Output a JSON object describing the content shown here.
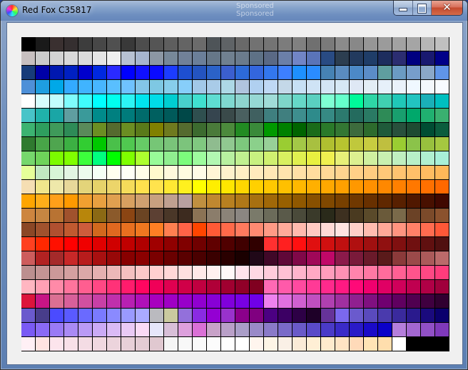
{
  "window": {
    "title": "Red Fox C35817",
    "background_ghost_text": "Sponsored\nSponsored",
    "close_symbol": "✕"
  },
  "palette": {
    "columns": 30,
    "rows": 22,
    "colors": [
      "#000000",
      "#1a1a1a",
      "#3a3030",
      "#352f30",
      "#3d3d3d",
      "#474747",
      "#505050",
      "#393939",
      "#4d4d4d",
      "#555555",
      "#5e5e5e",
      "#646464",
      "#6b6b6b",
      "#4e5458",
      "#5f6366",
      "#696969",
      "#727272",
      "#747474",
      "#7c7c7c",
      "#808080",
      "#707070",
      "#7a7a7a",
      "#8b8b8b",
      "#888888",
      "#969696",
      "#9b9b9b",
      "#a2a2a2",
      "#a5a5a5",
      "#b6b6b6",
      "#c0c0c0",
      "#c8c0c0",
      "#cbcbcb",
      "#d3d3d3",
      "#d9d9d9",
      "#dcdcdc",
      "#e5e5e5",
      "#efefef",
      "#b7c1d2",
      "#a6b5ce",
      "#8c97a4",
      "#778899",
      "#718198",
      "#6b7f99",
      "#667788",
      "#708090",
      "#6b7b8c",
      "#5e7186",
      "#5a6985",
      "#6b7fa8",
      "#7185c6",
      "#5a74b8",
      "#294b83",
      "#2c3e50",
      "#223a5e",
      "#1f3d68",
      "#1d2d5e",
      "#2b2d71",
      "#000080",
      "#191970",
      "#000088",
      "#183c7a",
      "#0000a8",
      "#0018b0",
      "#0020c2",
      "#0000cd",
      "#0028e0",
      "#2a2aff",
      "#0000ff",
      "#1010ff",
      "#0a0aff",
      "#1c3cff",
      "#1e4fd0",
      "#2454c0",
      "#2b62c8",
      "#3b5fcf",
      "#2d6ad8",
      "#3366dd",
      "#3377ee",
      "#3d7fff",
      "#1e90ff",
      "#2a8cff",
      "#4682b4",
      "#5a8cc0",
      "#4c89c7",
      "#5b8dc8",
      "#5f9ea0",
      "#6b9bc3",
      "#779ecb",
      "#8ba8c8",
      "#6095e8",
      "#4e90d8",
      "#1e9ee0",
      "#00a8e8",
      "#33aaff",
      "#40b4ff",
      "#47b6ff",
      "#59bfff",
      "#6fc2ff",
      "#83c5e8",
      "#7ec8e3",
      "#87ceeb",
      "#87cefa",
      "#a2c8e8",
      "#a9cbe8",
      "#add8e6",
      "#b0c4de",
      "#b0d0f0",
      "#bfd8f5",
      "#c4d8e8",
      "#c7e0f5",
      "#cfe3f5",
      "#d3e5f5",
      "#d6e8f5",
      "#dfe8f5",
      "#e3edf5",
      "#e6f0fa",
      "#eaf2fa",
      "#f0f8ff",
      "#f4f8fc",
      "#f8fbff",
      "#ffffff",
      "#d7fdfd",
      "#c1fdfd",
      "#7ffcfc",
      "#40fcfc",
      "#00ffff",
      "#00ffee",
      "#2cf4f4",
      "#00e5ee",
      "#00dce8",
      "#00ced1",
      "#48d1cc",
      "#40e0d0",
      "#5fdcd2",
      "#7fd8d0",
      "#8ed4ce",
      "#96d8d4",
      "#a0dcd8",
      "#7ed6c9",
      "#66d8c8",
      "#5ad0c0",
      "#7fffd4",
      "#66ffcc",
      "#00fa9a",
      "#2ed6a6",
      "#40d0b0",
      "#20c8b8",
      "#22c4c0",
      "#1ab0b8",
      "#00bfbf",
      "#48c4c8",
      "#20b2aa",
      "#1aa6a6",
      "#5f9ea0",
      "#3a9a9a",
      "#008b8b",
      "#008080",
      "#007b7b",
      "#006b6b",
      "#006060",
      "#005a5a",
      "#004848",
      "#2f4f4f",
      "#36454f",
      "#3a4a4a",
      "#4a6060",
      "#406060",
      "#3f7f7f",
      "#407f7f",
      "#3e8e8e",
      "#2e8b8b",
      "#368a84",
      "#2c7a6e",
      "#246b5e",
      "#2a7a64",
      "#2e8b57",
      "#199f6e",
      "#00a86b",
      "#20b070",
      "#3ab070",
      "#3cb371",
      "#2e9e5e",
      "#3f9a5a",
      "#2e8b57",
      "#5a8a5a",
      "#6b8e23",
      "#556b2f",
      "#6b8e23",
      "#5a7a1a",
      "#808000",
      "#6f7a1f",
      "#556b2f",
      "#3c6b2f",
      "#4a7a3a",
      "#4c8a3c",
      "#228b22",
      "#3a8a3a",
      "#009900",
      "#008000",
      "#006400",
      "#1a6b1a",
      "#2a7a2a",
      "#337733",
      "#3d6b3d",
      "#2d6b2d",
      "#1f5a3a",
      "#28503c",
      "#1e4b32",
      "#004d33",
      "#0b5d3d",
      "#2f7a2f",
      "#48a548",
      "#4fa54f",
      "#3cb043",
      "#32cd32",
      "#00c800",
      "#4ac04a",
      "#50c850",
      "#66cc66",
      "#76c676",
      "#7ac47a",
      "#7cc47c",
      "#80c880",
      "#8fbc8f",
      "#90c890",
      "#7dc87d",
      "#8bd08b",
      "#98d098",
      "#9acd32",
      "#a3c847",
      "#a8c040",
      "#b0c030",
      "#b8c430",
      "#c0c83c",
      "#c8cc40",
      "#bfbf3f",
      "#9acd32",
      "#8bc34a",
      "#98c03e",
      "#a5c840",
      "#76d76c",
      "#6ed35a",
      "#7cfc00",
      "#80ff00",
      "#3cff3c",
      "#00ff7f",
      "#00ff00",
      "#7fff00",
      "#adff2f",
      "#98fb98",
      "#90ee90",
      "#7cfc7c",
      "#9efc9e",
      "#b2f7b2",
      "#b8f0a0",
      "#c0f090",
      "#c8f080",
      "#d0f070",
      "#d8f060",
      "#e0f050",
      "#e8f040",
      "#f0f050",
      "#e8f078",
      "#dcf090",
      "#d0f0a0",
      "#c8f0b0",
      "#c0f0c0",
      "#b8f0c8",
      "#b0f0d0",
      "#a8f0d8",
      "#e6ff99",
      "#c1e8c1",
      "#d7f5d7",
      "#e3f5e3",
      "#edfced",
      "#f5fff5",
      "#fffff0",
      "#fffff5",
      "#fffde7",
      "#fffacd",
      "#fff8dc",
      "#fffce0",
      "#fffbe6",
      "#fff5d6",
      "#fff2cc",
      "#ffefc4",
      "#ffebbd",
      "#ffe8b5",
      "#ffe4ad",
      "#ffe0a6",
      "#ffdc9e",
      "#ffd896",
      "#ffd48f",
      "#ffd087",
      "#ffcc80",
      "#ffc878",
      "#ffc470",
      "#ffc069",
      "#ffbc61",
      "#ffb859",
      "#f5deb3",
      "#f0e68c",
      "#eee8aa",
      "#e8d89a",
      "#e3d47a",
      "#e6d36a",
      "#ecd56a",
      "#f5dc5a",
      "#ffe14d",
      "#ffe34d",
      "#ffe833",
      "#fff01f",
      "#ffff00",
      "#ffee00",
      "#ffe600",
      "#ffd700",
      "#ffd000",
      "#ffc800",
      "#ffc000",
      "#ffb800",
      "#ffb000",
      "#ffa800",
      "#ffa000",
      "#ff9800",
      "#ff9000",
      "#ff8800",
      "#ff8000",
      "#ff7800",
      "#ff7000",
      "#ff6800",
      "#ffa500",
      "#ffae1a",
      "#ff9f1a",
      "#ff9900",
      "#f0a030",
      "#e8a040",
      "#e0a050",
      "#d8a060",
      "#d0a070",
      "#c8a080",
      "#c0a090",
      "#b8a0a0",
      "#c09040",
      "#c08830",
      "#b88020",
      "#b07818",
      "#a87010",
      "#a06808",
      "#986000",
      "#905800",
      "#885000",
      "#804800",
      "#784000",
      "#703800",
      "#683000",
      "#602800",
      "#582000",
      "#501800",
      "#481000",
      "#400800",
      "#cd853f",
      "#c68642",
      "#b87333",
      "#a0522d",
      "#b8860b",
      "#8b6914",
      "#8b5a2b",
      "#8b4513",
      "#6b4423",
      "#5c4033",
      "#4a3728",
      "#3d2b1f",
      "#8b7355",
      "#8b7d6b",
      "#8b8378",
      "#8b8682",
      "#7a7a6a",
      "#6b6b5a",
      "#5a5a4a",
      "#4a4a3a",
      "#3a3a2a",
      "#2a2a1a",
      "#3d3020",
      "#4a3a20",
      "#5a4a2a",
      "#6a5a3a",
      "#7a6a4a",
      "#6b4226",
      "#7b4a2a",
      "#8b522e",
      "#8b4726",
      "#a0522d",
      "#b05030",
      "#c05a30",
      "#cd5c3c",
      "#d2691e",
      "#e06820",
      "#e87020",
      "#f07820",
      "#ff7f24",
      "#ff7f50",
      "#ff6347",
      "#ff4500",
      "#ff5a36",
      "#ff6a4a",
      "#ff7a5e",
      "#ff8a72",
      "#ff9a86",
      "#ffaa9a",
      "#ffbaae",
      "#ffcac2",
      "#ffdad6",
      "#ffe4e1",
      "#ffd0c8",
      "#ffbcb0",
      "#ffa898",
      "#ff9480",
      "#ff8068",
      "#ff6c50",
      "#ff5838",
      "#ff4020",
      "#ff2800",
      "#ff1000",
      "#ff0000",
      "#f00000",
      "#e00000",
      "#d00000",
      "#c00000",
      "#b00000",
      "#a00000",
      "#900000",
      "#800000",
      "#700000",
      "#600000",
      "#500000",
      "#400000",
      "#300000",
      "#ff3030",
      "#ff2020",
      "#ff1010",
      "#e01010",
      "#d01010",
      "#c01010",
      "#b01010",
      "#a01010",
      "#901010",
      "#801010",
      "#701010",
      "#601010",
      "#501010",
      "#cd5c5c",
      "#b22222",
      "#a52a2a",
      "#c82828",
      "#b81c1c",
      "#a81010",
      "#980808",
      "#880000",
      "#8b0000",
      "#7a0000",
      "#6a0000",
      "#5a0000",
      "#4a0000",
      "#3a0000",
      "#2a0000",
      "#1a0000",
      "#200818",
      "#400828",
      "#600838",
      "#800848",
      "#a00858",
      "#c00868",
      "#8b1a4a",
      "#7a1a3a",
      "#6a1a2a",
      "#5a1a1a",
      "#8b3a3a",
      "#9b4a4a",
      "#ab5a5a",
      "#bb6a6a",
      "#bc8f8f",
      "#c49494",
      "#cc9999",
      "#d4a0a0",
      "#dca8a8",
      "#e4b0b0",
      "#ecb8b8",
      "#f4c0c0",
      "#fcc8c8",
      "#ffd0d0",
      "#ffd8d8",
      "#ffe0e0",
      "#ffe8e8",
      "#fff0f0",
      "#fff8f8",
      "#ffe4ec",
      "#ffd8e4",
      "#ffccdc",
      "#ffc0d4",
      "#ffb4cc",
      "#ffa8c4",
      "#ff9cbc",
      "#ff90b4",
      "#ff84ac",
      "#ff78a4",
      "#ff6c9c",
      "#ff6094",
      "#ff548c",
      "#ff4884",
      "#ff3c7c",
      "#ffb6c1",
      "#ffa0b4",
      "#ff8aa8",
      "#ff749c",
      "#ff5e90",
      "#ff4884",
      "#ff3278",
      "#ff1c6c",
      "#ff0660",
      "#f00058",
      "#e00050",
      "#d00048",
      "#c00040",
      "#b00038",
      "#a00030",
      "#900028",
      "#800020",
      "#ff69b4",
      "#ff5aaa",
      "#ff4aa0",
      "#ff3a96",
      "#ff2a8c",
      "#ff1a82",
      "#ff0a78",
      "#f0006e",
      "#e00064",
      "#d0005a",
      "#c00050",
      "#b00046",
      "#a0003c",
      "#dc143c",
      "#c71585",
      "#db7093",
      "#d8609a",
      "#d050a0",
      "#c840a6",
      "#c030ac",
      "#b820b2",
      "#b010b8",
      "#a800be",
      "#a000c4",
      "#9800ca",
      "#9000d0",
      "#8800d6",
      "#8000dc",
      "#7800e2",
      "#7000e8",
      "#ee82ee",
      "#e070e0",
      "#d060d0",
      "#c050c0",
      "#b040b0",
      "#a030a0",
      "#902090",
      "#801080",
      "#700070",
      "#600060",
      "#500050",
      "#400040",
      "#300030",
      "#6a5acd",
      "#483d8b",
      "#4b4bff",
      "#5a5aff",
      "#6a6aff",
      "#7a7aff",
      "#8a8aff",
      "#9a9aff",
      "#aaaaff",
      "#bababf",
      "#caca9f",
      "#9370db",
      "#8a2be2",
      "#9400d3",
      "#9932cc",
      "#8b008b",
      "#800080",
      "#4b0082",
      "#3c0064",
      "#2d0046",
      "#1e0028",
      "#663399",
      "#7b68ee",
      "#6a5acd",
      "#5a4abd",
      "#4a3aad",
      "#3a2a9d",
      "#2a1a8d",
      "#1a0a7d",
      "#0a006d",
      "#7a5af5",
      "#8a6af5",
      "#9a7af5",
      "#aa8af5",
      "#ba9af5",
      "#caaaf5",
      "#dabaf5",
      "#eacaf5",
      "#fadaf5",
      "#e6e6fa",
      "#d8bfd8",
      "#dda0dd",
      "#da70d6",
      "#c8a2c8",
      "#b9a0c8",
      "#aa9ec8",
      "#9a8ac8",
      "#8a7ac8",
      "#7a6ac8",
      "#6a5ac8",
      "#5a4ac8",
      "#4a3ac8",
      "#3a2ac8",
      "#2a1ac8",
      "#1a0ac8",
      "#0a00c8",
      "#b57edc",
      "#a367d1",
      "#9150c6",
      "#7f39bb",
      "#fff0f5",
      "#ffe4e1",
      "#fce4ec",
      "#f8e0e8",
      "#f4dce4",
      "#f0d8e0",
      "#ecd4dc",
      "#e8d0d8",
      "#e4ccd4",
      "#e0c8d0",
      "#f5f5f5",
      "#f8f8f8",
      "#fafafa",
      "#fcfcfc",
      "#fefefe",
      "#ffffff",
      "#fff5ee",
      "#fdf5e6",
      "#faf0e6",
      "#faebd7",
      "#ffefd5",
      "#ffebcd",
      "#ffe4c4",
      "#ffdab9",
      "#ffe4b5",
      "#ffdead",
      "#ffffff",
      "#000000",
      "#000000",
      "#000000"
    ]
  }
}
